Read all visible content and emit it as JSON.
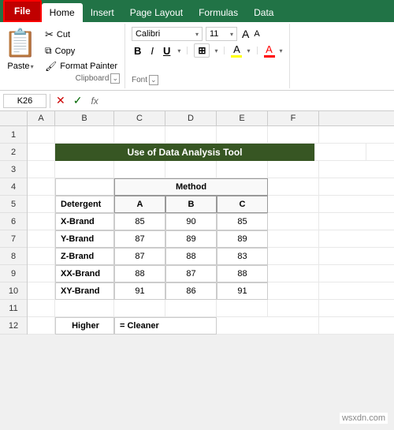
{
  "ribbon": {
    "tabs": [
      "File",
      "Home",
      "Insert",
      "Page Layout",
      "Formulas",
      "Data"
    ],
    "active_tab": "Home",
    "file_tab": "File"
  },
  "clipboard": {
    "paste_label": "Paste",
    "cut_label": "Cut",
    "copy_label": "Copy",
    "format_painter_label": "Format Painter",
    "group_label": "Clipboard"
  },
  "font": {
    "family": "Calibri",
    "size": "11",
    "bold": "B",
    "italic": "I",
    "underline": "U",
    "group_label": "Font"
  },
  "formula_bar": {
    "cell_ref": "K26",
    "fx_label": "fx"
  },
  "spreadsheet": {
    "title": "Use of Data Analysis Tool",
    "col_headers": [
      "A",
      "B",
      "C",
      "D",
      "E",
      "F"
    ],
    "row_headers": [
      "1",
      "2",
      "3",
      "4",
      "5",
      "6",
      "7",
      "8",
      "9",
      "10",
      "11",
      "12"
    ],
    "method_label": "Method",
    "headers": {
      "detergent": "Detergent",
      "a": "A",
      "b": "B",
      "c": "C"
    },
    "rows": [
      {
        "brand": "X-Brand",
        "a": "85",
        "b": "90",
        "c": "85"
      },
      {
        "brand": "Y-Brand",
        "a": "87",
        "b": "89",
        "c": "89"
      },
      {
        "brand": "Z-Brand",
        "a": "87",
        "b": "88",
        "c": "83"
      },
      {
        "brand": "XX-Brand",
        "a": "88",
        "b": "87",
        "c": "88"
      },
      {
        "brand": "XY-Brand",
        "a": "91",
        "b": "86",
        "c": "91"
      }
    ],
    "footer": {
      "higher": "Higher",
      "cleaner": "= Cleaner"
    }
  },
  "watermark": "wsxdn.com"
}
